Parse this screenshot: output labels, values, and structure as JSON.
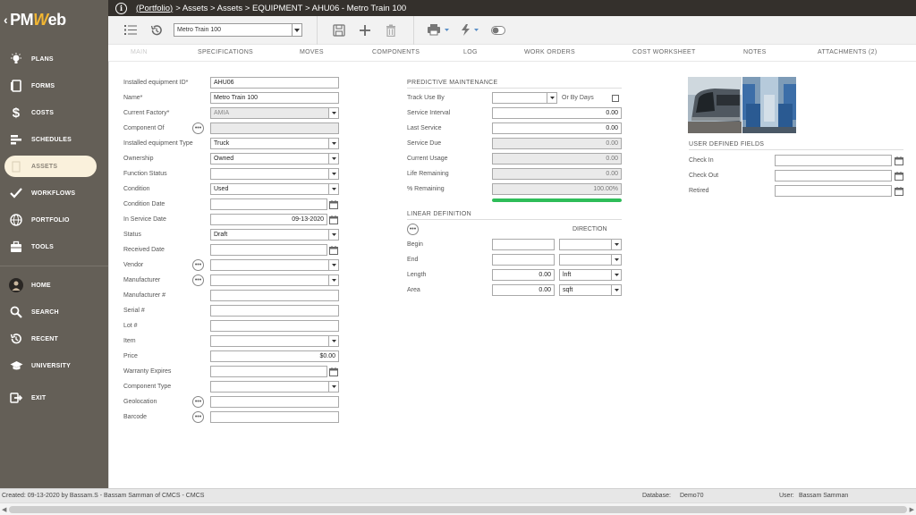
{
  "app": {
    "logo_text": "PM",
    "logo_w": "W",
    "logo_suffix": "eb"
  },
  "nav": {
    "items": [
      {
        "label": "PLANS",
        "icon": "bulb-icon"
      },
      {
        "label": "FORMS",
        "icon": "document-icon"
      },
      {
        "label": "COSTS",
        "icon": "dollar-icon"
      },
      {
        "label": "SCHEDULES",
        "icon": "gantt-icon"
      },
      {
        "label": "ASSETS",
        "icon": "building-icon",
        "active": true
      },
      {
        "label": "WORKFLOWS",
        "icon": "check-icon"
      },
      {
        "label": "PORTFOLIO",
        "icon": "globe-icon"
      },
      {
        "label": "TOOLS",
        "icon": "toolbox-icon"
      }
    ],
    "bottom": [
      {
        "label": "HOME",
        "icon": "avatar-icon"
      },
      {
        "label": "SEARCH",
        "icon": "search-icon"
      },
      {
        "label": "RECENT",
        "icon": "history-icon"
      },
      {
        "label": "UNIVERSITY",
        "icon": "graduation-cap-icon"
      },
      {
        "label": "EXIT",
        "icon": "exit-icon"
      }
    ]
  },
  "breadcrumb": {
    "link": "(Portfolio)",
    "rest": "> Assets > Assets > EQUIPMENT > AHU06 - Metro Train 100"
  },
  "toolbar": {
    "record_select": "Metro Train 100"
  },
  "tabs": [
    "MAIN",
    "SPECIFICATIONS",
    "MOVES",
    "COMPONENTS",
    "LOG",
    "WORK ORDERS",
    "COST WORKSHEET",
    "NOTES",
    "ATTACHMENTS (2)"
  ],
  "form": {
    "installed_id": {
      "label": "Installed equipment ID*",
      "value": "AHU06"
    },
    "name": {
      "label": "Name*",
      "value": "Metro Train 100"
    },
    "current_factory": {
      "label": "Current Factory*",
      "value": "AMIA"
    },
    "component_of": {
      "label": "Component Of",
      "value": ""
    },
    "equipment_type": {
      "label": "Installed equipment Type",
      "value": "Truck"
    },
    "ownership": {
      "label": "Ownership",
      "value": "Owned"
    },
    "function_status": {
      "label": "Function Status",
      "value": ""
    },
    "condition": {
      "label": "Condition",
      "value": "Used"
    },
    "condition_date": {
      "label": "Condition Date",
      "value": ""
    },
    "in_service_date": {
      "label": "In Service Date",
      "value": "09-13-2020"
    },
    "status": {
      "label": "Status",
      "value": "Draft"
    },
    "received_date": {
      "label": "Received Date",
      "value": ""
    },
    "vendor": {
      "label": "Vendor",
      "value": ""
    },
    "manufacturer": {
      "label": "Manufacturer",
      "value": ""
    },
    "manufacturer_no": {
      "label": "Manufacturer #",
      "value": ""
    },
    "serial_no": {
      "label": "Serial #",
      "value": ""
    },
    "lot_no": {
      "label": "Lot #",
      "value": ""
    },
    "item": {
      "label": "Item",
      "value": ""
    },
    "price": {
      "label": "Price",
      "value": "$0.00"
    },
    "warranty_expires": {
      "label": "Warranty Expires",
      "value": ""
    },
    "component_type": {
      "label": "Component Type",
      "value": ""
    },
    "geolocation": {
      "label": "Geolocation",
      "value": ""
    },
    "barcode": {
      "label": "Barcode",
      "value": ""
    }
  },
  "predictive": {
    "title": "PREDICTIVE MAINTENANCE",
    "track_use_by": {
      "label": "Track Use By",
      "value": ""
    },
    "or_by_days": {
      "label": "Or By Days"
    },
    "service_interval": {
      "label": "Service Interval",
      "value": "0.00"
    },
    "last_service": {
      "label": "Last Service",
      "value": "0.00"
    },
    "service_due": {
      "label": "Service Due",
      "value": "0.00"
    },
    "current_usage": {
      "label": "Current Usage",
      "value": "0.00"
    },
    "life_remaining": {
      "label": "Life Remaining",
      "value": "0.00"
    },
    "pct_remaining": {
      "label": "% Remaining",
      "value": "100.00%"
    },
    "progress_fraction": 1.0,
    "progress_color": "#2ebd59"
  },
  "linear": {
    "title": "LINEAR DEFINITION",
    "direction_label": "DIRECTION",
    "begin": {
      "label": "Begin",
      "value": "",
      "direction": ""
    },
    "end": {
      "label": "End",
      "value": "",
      "direction": ""
    },
    "length": {
      "label": "Length",
      "value": "0.00",
      "unit": "lnft"
    },
    "area": {
      "label": "Area",
      "value": "0.00",
      "unit": "sqft"
    }
  },
  "udf": {
    "title": "USER DEFINED FIELDS",
    "check_in": {
      "label": "Check In",
      "value": ""
    },
    "check_out": {
      "label": "Check Out",
      "value": ""
    },
    "retired": {
      "label": "Retired",
      "value": ""
    }
  },
  "status_bar": {
    "created": "Created:  09-13-2020 by Bassam.S - Bassam Samman of CMCS - CMCS",
    "database_label": "Database:",
    "database": "Demo70",
    "user_label": "User:",
    "user": "Bassam Samman"
  },
  "colors": {
    "sidebar": "#645f57",
    "topbar": "#34302c",
    "active_nav": "#faf1dc",
    "logo_accent": "#f2b632"
  }
}
